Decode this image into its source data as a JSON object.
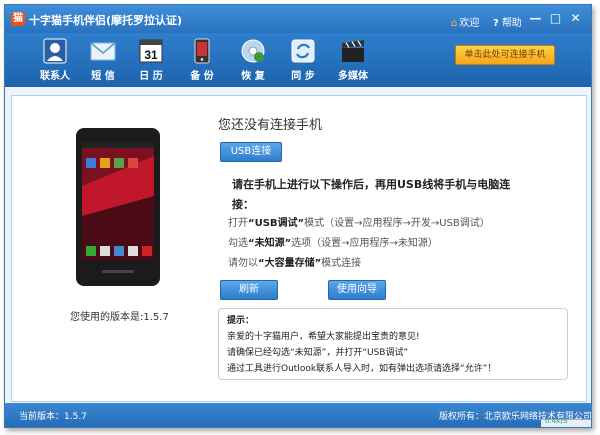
{
  "app": {
    "title": "十字猫手机伴侣(摩托罗拉认证)",
    "logo_char": "猫",
    "welcome": "欢迎",
    "help": "帮助"
  },
  "window_controls": {
    "minimize": "—",
    "maximize": "□",
    "close": "✕"
  },
  "toolbar": {
    "items": [
      {
        "label": "联系人",
        "icon": "contacts-icon"
      },
      {
        "label": "短 信",
        "icon": "sms-icon"
      },
      {
        "label": "日 历",
        "icon": "calendar-icon",
        "day": "31"
      },
      {
        "label": "备 份",
        "icon": "backup-icon"
      },
      {
        "label": "恢 复",
        "icon": "restore-icon"
      },
      {
        "label": "同 步",
        "icon": "sync-icon"
      },
      {
        "label": "多媒体",
        "icon": "media-icon"
      }
    ],
    "connect_label": "单击此处可连接手机"
  },
  "main": {
    "heading": "您还没有连接手机",
    "usb_button": "USB连接",
    "instruction": "请在手机上进行以下操作后，再用USB线将手机与电脑连",
    "instruction2": "接：",
    "step1_pre": "打开",
    "step1_bold": "“USB调试”",
    "step1_post": "模式（设置→应用程序→开发→USB调试）",
    "step2_pre": "勾选",
    "step2_bold": "“未知源”",
    "step2_post": "选项（设置→应用程序→未知源）",
    "step3_pre": "请勿以",
    "step3_bold": "“大容量存储”",
    "step3_post": "模式连接",
    "refresh_button": "刷新",
    "guide_button": "使用向导",
    "version_text": "您使用的版本是:1.5.7"
  },
  "tips": {
    "title": "提示：",
    "lines": [
      "亲爱的十字猫用户，希望大家能提出宝贵的意见!",
      "请确保已经勾选“未知源”，并打开“USB调试”",
      "通过工具进行Outlook联系人导入时，如有弹出选项请选择“允许”！"
    ]
  },
  "status": {
    "version": "当前版本：1.5.7",
    "copyright": "版权所有：北京欧乐网络技术有限公司",
    "net": "0.4K/S"
  },
  "colors": {
    "accent": "#2a72bf",
    "connect": "#f3a617"
  }
}
